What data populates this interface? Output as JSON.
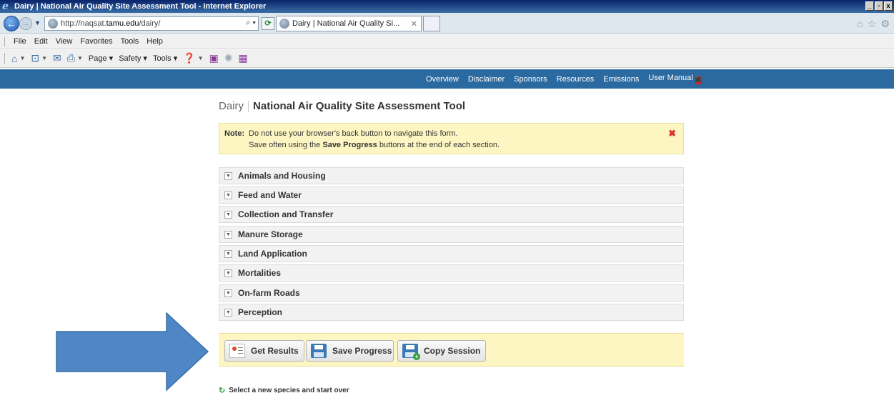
{
  "window": {
    "title": "Dairy | National Air Quality Site Assessment Tool - Internet Explorer"
  },
  "address": {
    "url_prefix": "http://naqsat.",
    "url_host": "tamu.edu",
    "url_path": "/dairy/"
  },
  "tab": {
    "title": "Dairy | National Air Quality Si..."
  },
  "menu": [
    "File",
    "Edit",
    "View",
    "Favorites",
    "Tools",
    "Help"
  ],
  "commandbar": {
    "page": "Page",
    "safety": "Safety",
    "tools": "Tools"
  },
  "sitenav": [
    "Overview",
    "Disclaimer",
    "Sponsors",
    "Resources",
    "Emissions",
    "User Manual"
  ],
  "page": {
    "species": "Dairy",
    "tool_title": "National Air Quality Site Assessment Tool"
  },
  "note": {
    "label": "Note:",
    "line1": "Do not use your browser's back button to navigate this form.",
    "line2_pre": "Save often using the ",
    "line2_bold": "Save Progress",
    "line2_post": " buttons at the end of each section."
  },
  "sections": [
    "Animals and Housing",
    "Feed and Water",
    "Collection and Transfer",
    "Manure Storage",
    "Land Application",
    "Mortalities",
    "On-farm Roads",
    "Perception"
  ],
  "buttons": {
    "get_results": "Get Results",
    "save_progress": "Save Progress",
    "copy_session": "Copy Session"
  },
  "startover": "Select a new species and start over",
  "colors": {
    "nav_blue": "#2b6aa0",
    "note_bg": "#fdf6c3",
    "arrow_blue": "#4f86c6"
  }
}
